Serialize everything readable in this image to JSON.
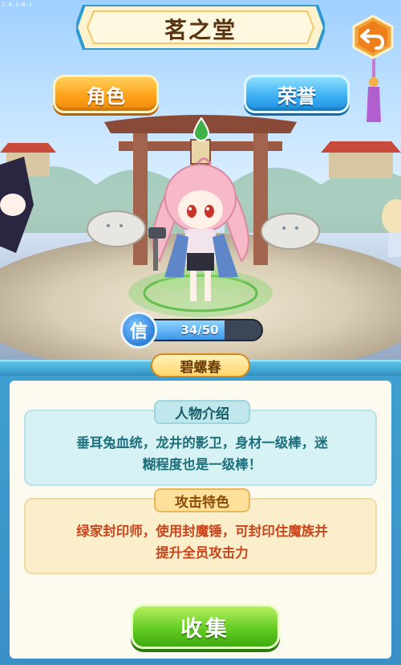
{
  "header": {
    "version": "1.4.1-8-1",
    "title": "茗之堂",
    "back_icon": "back-arrow-icon"
  },
  "tabs": [
    {
      "label": "角色",
      "active": true,
      "color": "#ffa21c"
    },
    {
      "label": "荣誉",
      "active": false,
      "color": "#3fb1f2"
    }
  ],
  "character": {
    "name": "碧螺春",
    "trust": {
      "icon_label": "信",
      "current": 34,
      "max": 50,
      "text": "34/50"
    }
  },
  "sections": {
    "intro": {
      "heading": "人物介绍",
      "line1": "垂耳兔血统，龙井的影卫，身材一级棒，迷",
      "line2": "糊程度也是一级棒！"
    },
    "attack": {
      "heading": "攻击特色",
      "line1": "绿家封印师，使用封魔锤，可封印住魔族并",
      "line2": "提升全员攻击力"
    }
  },
  "actions": {
    "collect_label": "收集"
  },
  "colors": {
    "panel_blue": "#3e9fd0",
    "intro_text": "#1c6f7d",
    "attack_text": "#c8461c",
    "collect_green": "#64cc23"
  }
}
